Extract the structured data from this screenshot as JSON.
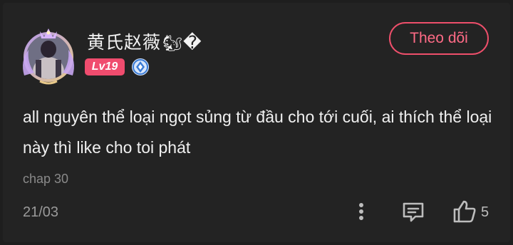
{
  "comment": {
    "username": "黄氏赵薇",
    "username_suffix_emoji": "🐿",
    "username_suffix_glyph": "�",
    "level_badge": "Lv19",
    "follow_label": "Theo dõi",
    "text": "all nguyên thể loại ngọt sủng từ đầu cho tới cuối, ai thích thể loại này thì like cho toi phát",
    "chapter": "chap 30",
    "date": "21/03",
    "like_count": "5"
  },
  "icons": {
    "verify": "verified-shield-icon",
    "more": "more-vertical-icon",
    "reply": "reply-comment-icon",
    "like": "thumbs-up-icon"
  },
  "colors": {
    "background": "#1e1e1e",
    "accent": "#ee4f6b",
    "level_badge": "#f04c6e",
    "verify_blue": "#3a7bd5"
  }
}
